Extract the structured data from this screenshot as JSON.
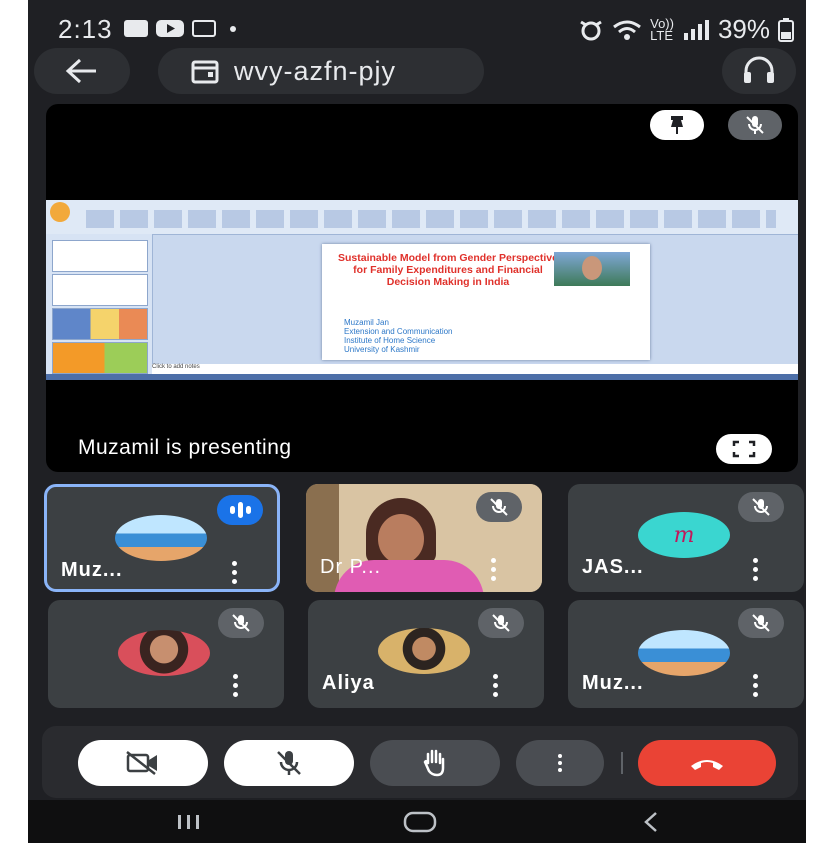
{
  "status_bar": {
    "time": "2:13",
    "network": "Vo))",
    "network_sub": "LTE",
    "battery": "39%",
    "icons": [
      "gallery-icon",
      "youtube-icon",
      "voicemail-icon",
      "alarm-icon",
      "wifi-icon",
      "signal-icon",
      "battery-icon"
    ]
  },
  "top_bar": {
    "meeting_code": "wvy-azfn-pjy",
    "icons": [
      "back-arrow-icon",
      "calendar-icon",
      "headphones-icon"
    ]
  },
  "presentation": {
    "caption": "Muzamil is presenting",
    "slide": {
      "title": "Sustainable Model from Gender Perspective for Family Expenditures and Financial Decision Making in India",
      "author": "Muzamil Jan",
      "dept": "Extension and Communication",
      "institute": "Institute of Home Science",
      "university": "University of Kashmir",
      "notes": "Click to add notes"
    }
  },
  "tiles": [
    {
      "name": "Muz...",
      "state": "speaking"
    },
    {
      "name": "Dr P...",
      "state": "muted"
    },
    {
      "name": "JAS...",
      "state": "muted",
      "avatar_letter": "m"
    },
    {
      "name": "",
      "state": "muted"
    },
    {
      "name": "Aliya",
      "state": "muted"
    },
    {
      "name": "Muz...",
      "state": "muted"
    }
  ],
  "colors": {
    "background": "#1f2024",
    "tile": "#3c4043",
    "pill": "#2d2f33",
    "end_call": "#ea4335",
    "speaking_border": "#8ab4f8",
    "speaking_chip": "#1a73e8",
    "avatar_teal": "#3ad6d0"
  }
}
